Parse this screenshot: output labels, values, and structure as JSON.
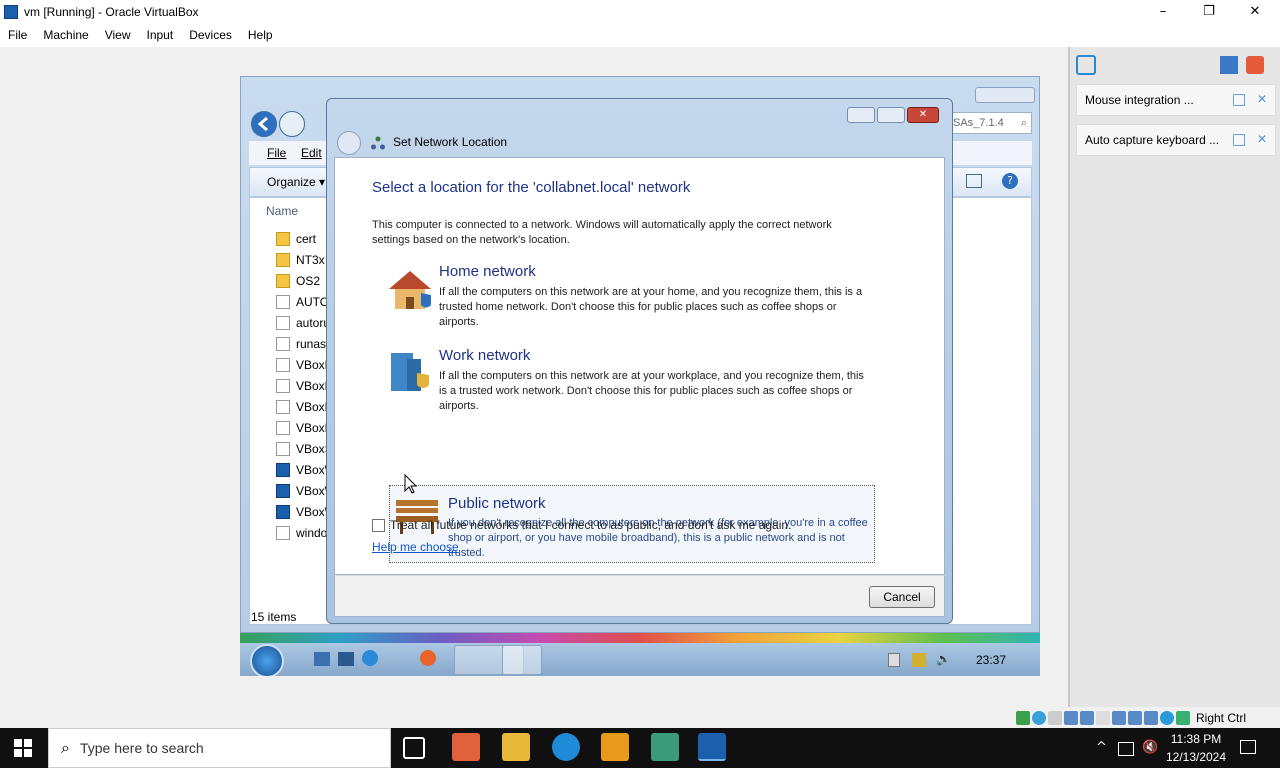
{
  "host": {
    "title": "vm [Running] - Oracle VirtualBox",
    "menu": [
      "File",
      "Machine",
      "View",
      "Input",
      "Devices",
      "Help"
    ],
    "controls": {
      "minimize": "–",
      "restore": "❐",
      "close": "✕"
    }
  },
  "explorer": {
    "menu": {
      "file": "File",
      "edit": "Edit"
    },
    "organize": "Organize ▾",
    "column_name": "Name",
    "address_tail": "SAs_7.1.4",
    "files": [
      "cert",
      "NT3x",
      "OS2",
      "AUTOR",
      "autorun",
      "runasro",
      "VBoxDa",
      "VBoxDa",
      "VBoxLin",
      "VBoxLin",
      "VBoxSo",
      "VBoxWi",
      "VBoxWi",
      "VBoxWi",
      "window"
    ],
    "status": "15 items"
  },
  "dialog": {
    "title": "Set Network Location",
    "heading": "Select a location for the 'collabnet.local' network",
    "intro": "This computer is connected to a network. Windows will automatically apply the correct network settings based on the network's location.",
    "options": [
      {
        "title": "Home network",
        "desc": "If all the computers on this network are at your home, and you recognize them, this is a trusted home network.  Don't choose this for public places such as coffee shops or airports."
      },
      {
        "title": "Work network",
        "desc": "If all the computers on this network are at your workplace, and you recognize them, this is a trusted work network.  Don't choose this for public places such as coffee shops or airports."
      },
      {
        "title": "Public network",
        "desc": "If you don't recognize all the computers on the network (for example, you're in a coffee shop or airport, or you have mobile broadband), this is a public network and is not trusted."
      }
    ],
    "checkbox_label": "Treat all future networks that I connect to as public, and don't ask me again.",
    "help_link": "Help me choose",
    "cancel": "Cancel"
  },
  "guest_taskbar": {
    "clock": "23:37"
  },
  "panel": {
    "items": [
      "Mouse integration ...",
      "Auto capture keyboard ..."
    ]
  },
  "statusbar": {
    "host_key": "Right Ctrl"
  },
  "win_taskbar": {
    "search_placeholder": "Type here to search",
    "time": "11:38 PM",
    "date": "12/13/2024"
  },
  "colors": {
    "accent": "#1e3287",
    "link": "#1155cc"
  }
}
